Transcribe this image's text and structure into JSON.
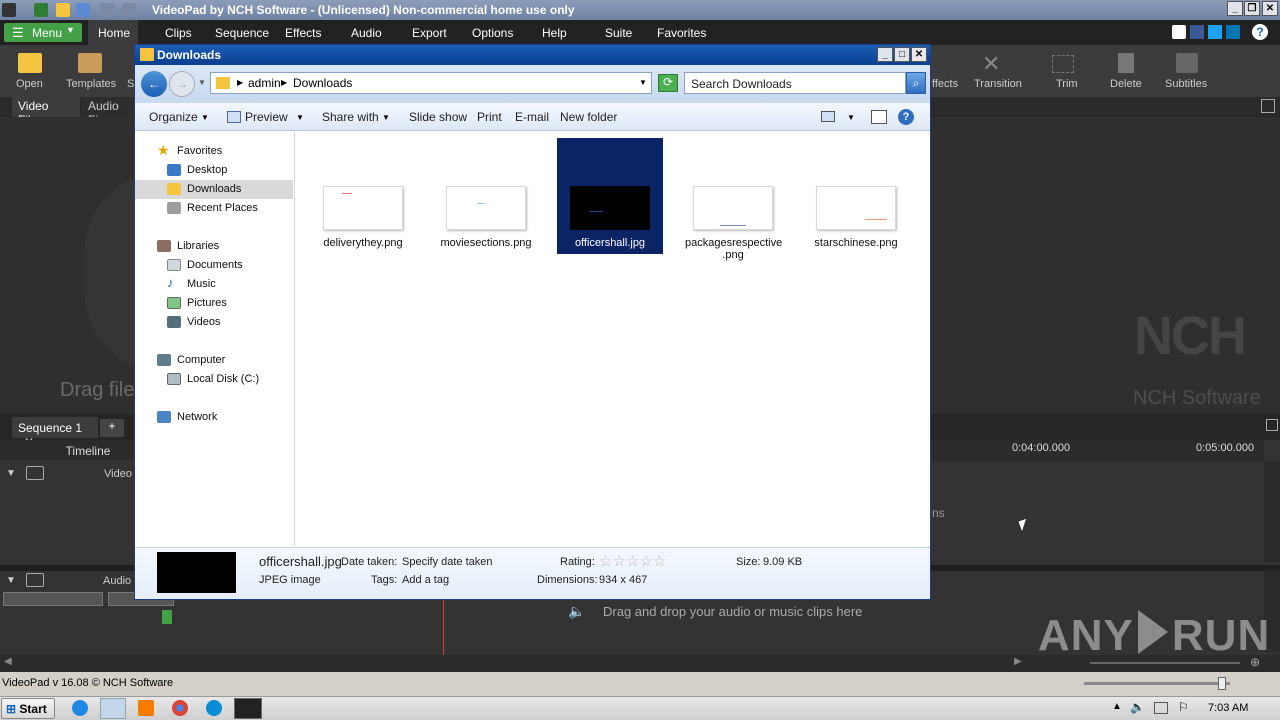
{
  "app": {
    "title": "VideoPad by NCH Software - (Unlicensed) Non-commercial home use only",
    "menu": [
      "Menu",
      "Home",
      "Clips",
      "Sequence",
      "Effects",
      "Audio",
      "Export",
      "Options",
      "Help",
      "Suite",
      "Favorites"
    ],
    "ribbon_left": [
      "Open",
      "Templates",
      "S"
    ],
    "ribbon_right": [
      "ffects",
      "Transition",
      "Trim",
      "Delete",
      "Subtitles"
    ],
    "panel_tabs": [
      "Video Files",
      "Audio Fi"
    ],
    "drag_hint": "Drag file",
    "watermark_logo": "NCH",
    "watermark_text": "NCH Software",
    "sequence_tab": "Sequence 1",
    "add_tab": "+",
    "timeline_label": "Timeline",
    "video_track": "Video",
    "audio_track": "Audio",
    "ruler_times": [
      "0:04:00.000",
      "0:05:00.000"
    ],
    "track_hint_partial": "ns",
    "audio_drop_hint": "Drag and drop your audio or music clips here",
    "status": "VideoPad v 16.08 © NCH Software"
  },
  "dialog": {
    "title": "Downloads",
    "breadcrumb": [
      "admin",
      "Downloads"
    ],
    "search_placeholder": "Search Downloads",
    "toolbar": [
      "Organize",
      "Preview",
      "Share with",
      "Slide show",
      "Print",
      "E-mail",
      "New folder"
    ],
    "nav": {
      "favorites": "Favorites",
      "fav_items": [
        "Desktop",
        "Downloads",
        "Recent Places"
      ],
      "libraries": "Libraries",
      "lib_items": [
        "Documents",
        "Music",
        "Pictures",
        "Videos"
      ],
      "computer": "Computer",
      "comp_items": [
        "Local Disk (C:)"
      ],
      "network": "Network"
    },
    "files": [
      {
        "name": "deliverythey.png"
      },
      {
        "name": "moviesections.png"
      },
      {
        "name": "officershall.jpg"
      },
      {
        "name": "packagesrespective .png"
      },
      {
        "name": "starschinese.png"
      }
    ],
    "details": {
      "filename": "officershall.jpg",
      "filetype": "JPEG image",
      "date_label": "Date taken:",
      "date_value": "Specify date taken",
      "tags_label": "Tags:",
      "tags_value": "Add a tag",
      "rating_label": "Rating:",
      "dimensions_label": "Dimensions:",
      "dimensions_value": "934 x 467",
      "size_label": "Size:",
      "size_value": "9.09 KB"
    }
  },
  "taskbar": {
    "start": "Start",
    "clock": "7:03 AM"
  },
  "overlay": {
    "brand": "ANY",
    "brand2": "RUN"
  }
}
